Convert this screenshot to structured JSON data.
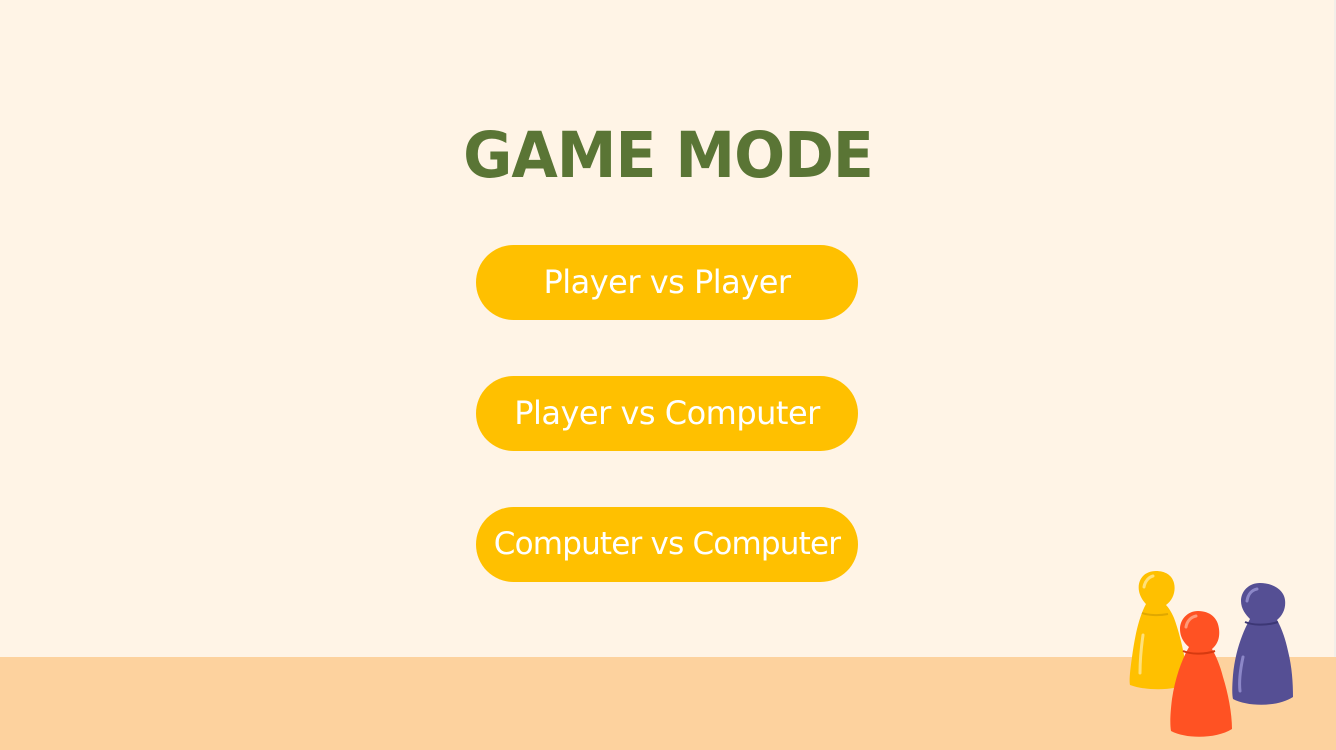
{
  "screen": {
    "title": "GAME MODE"
  },
  "mode_buttons": [
    {
      "label": "Player vs Player"
    },
    {
      "label": "Player vs Computer"
    },
    {
      "label": "Computer vs Computer"
    }
  ],
  "decoration": {
    "icon": "game-pawns-icon",
    "pawn_colors": [
      "#ffc000",
      "#ff5223",
      "#554f94"
    ]
  },
  "colors": {
    "background": "#fff4e6",
    "floor": "#fdd29e",
    "title": "#5a7535",
    "button": "#ffc000",
    "button_text": "#ffffff"
  }
}
